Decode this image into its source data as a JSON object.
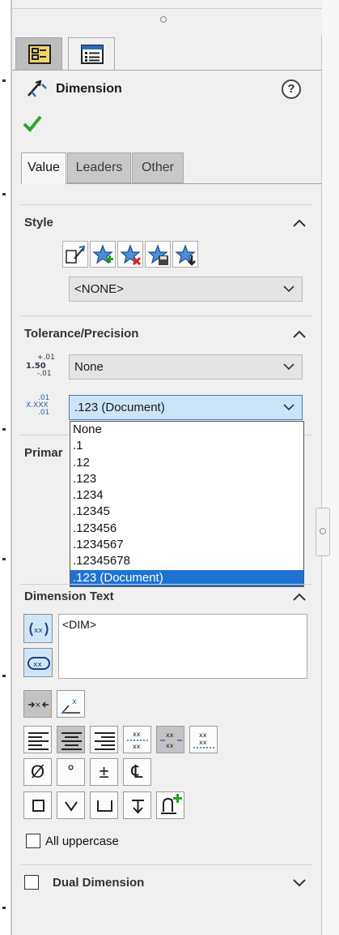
{
  "manager_tabs": [
    {
      "name": "property-manager-tab-1",
      "icon": "feature-tree-icon"
    },
    {
      "name": "property-manager-tab-2",
      "icon": "property-list-icon"
    }
  ],
  "header": {
    "title": "Dimension",
    "title_icon": "dimension-icon",
    "help_icon": "help-icon",
    "help_glyph": "?",
    "ok_icon": "checkmark-icon"
  },
  "tabs": [
    {
      "label": "Value",
      "active": true
    },
    {
      "label": "Leaders",
      "active": false
    },
    {
      "label": "Other",
      "active": false
    }
  ],
  "style_section": {
    "label": "Style",
    "buttons": [
      "apply-style-icon",
      "add-style-icon",
      "delete-style-icon",
      "save-style-icon",
      "load-style-icon"
    ],
    "combo_value": "<NONE>"
  },
  "tolerance_section": {
    "label": "Tolerance/Precision",
    "tolerance_icon_lines": [
      "+.01",
      "1.50",
      "-.01"
    ],
    "tolerance_value": "None",
    "precision_icon_lines": [
      ".01",
      "X.XXX",
      ".01"
    ],
    "precision_value": ".123 (Document)",
    "dropdown_options": [
      ".123 (Document)",
      "None",
      ".1",
      ".12",
      ".123",
      ".1234",
      ".12345",
      ".123456",
      ".1234567",
      ".12345678"
    ],
    "dropdown_items": [
      "None",
      ".1",
      ".12",
      ".123",
      ".1234",
      ".12345",
      ".123456",
      ".1234567",
      ".12345678",
      ".123 (Document)"
    ],
    "dropdown_selected": ".123 (Document)"
  },
  "primary_section": {
    "label": "Primar"
  },
  "dimension_text_section": {
    "label": "Dimension Text",
    "text_value": "<DIM>",
    "side_buttons": [
      "add-parentheses-icon",
      "inspection-dimension-icon"
    ],
    "toolbar_row1": [
      "justify-left-icon",
      "justify-center-icon",
      "justify-right-icon",
      "text-above-icon",
      "text-middle-icon",
      "text-below-icon"
    ],
    "toolbar_arrows": [
      "arrows-inside-icon",
      "arrows-outside-icon"
    ],
    "symbol_row": [
      {
        "icon": "diameter-symbol-icon",
        "glyph": "Ø"
      },
      {
        "icon": "degree-symbol-icon",
        "glyph": "°"
      },
      {
        "icon": "plus-minus-symbol-icon",
        "glyph": "±"
      },
      {
        "icon": "centerline-symbol-icon",
        "glyph": "℄"
      }
    ],
    "symbol_row2": [
      "square-symbol-icon",
      "countersink-symbol-icon",
      "counterbore-symbol-icon",
      "depth-symbol-icon",
      "more-symbols-icon"
    ]
  },
  "options": {
    "all_uppercase_label": "All uppercase",
    "all_uppercase_checked": false,
    "dual_dimension_label": "Dual Dimension",
    "dual_dimension_checked": false
  },
  "colors": {
    "accent": "#1e73d2",
    "check_green": "#2aa52a",
    "panel_bg": "#f0f0f0"
  }
}
